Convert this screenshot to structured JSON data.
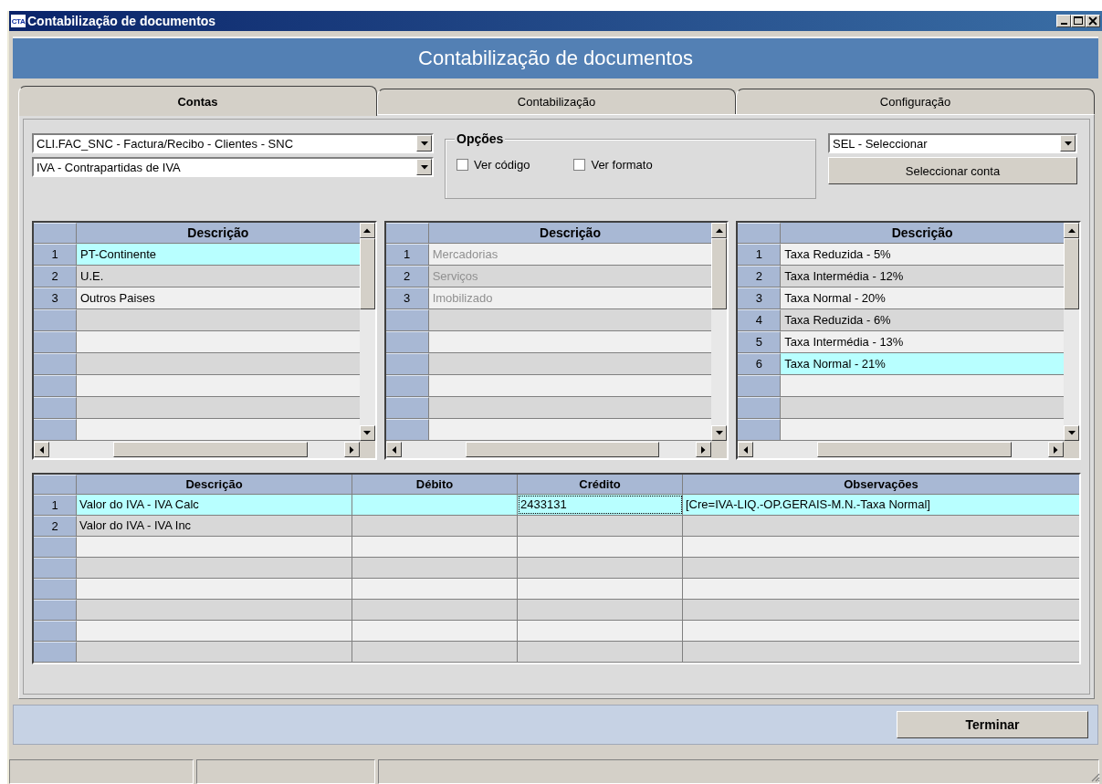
{
  "window": {
    "icon_label": "CTA",
    "title": "Contabilização de documentos"
  },
  "banner": "Contabilização de documentos",
  "tabs": [
    {
      "label": "Contas",
      "selected": true
    },
    {
      "label": "Contabilização",
      "selected": false
    },
    {
      "label": "Configuração",
      "selected": false
    }
  ],
  "document_type": {
    "value": "CLI.FAC_SNC - Factura/Recibo - Clientes - SNC"
  },
  "counterpart": {
    "value": "IVA - Contrapartidas de IVA"
  },
  "options": {
    "title": "Opções",
    "checkboxes": [
      {
        "label": "Ver código",
        "checked": false
      },
      {
        "label": "Ver formato",
        "checked": false
      }
    ]
  },
  "selection": {
    "value": "SEL - Seleccionar"
  },
  "select_account_button": "Seleccionar conta",
  "top_grids": [
    {
      "header": "Descrição",
      "disabled": false,
      "rows": [
        {
          "number": "1",
          "text": "PT-Continente",
          "selected": true
        },
        {
          "number": "2",
          "text": "U.E.",
          "selected": false
        },
        {
          "number": "3",
          "text": "Outros Paises",
          "selected": false
        }
      ]
    },
    {
      "header": "Descrição",
      "disabled": true,
      "rows": [
        {
          "number": "1",
          "text": "Mercadorias",
          "selected": false
        },
        {
          "number": "2",
          "text": "Serviços",
          "selected": false
        },
        {
          "number": "3",
          "text": "Imobilizado",
          "selected": false
        }
      ]
    },
    {
      "header": "Descrição",
      "disabled": false,
      "rows": [
        {
          "number": "1",
          "text": "Taxa Reduzida - 5%",
          "selected": false
        },
        {
          "number": "2",
          "text": "Taxa Intermédia - 12%",
          "selected": false
        },
        {
          "number": "3",
          "text": "Taxa Normal - 20%",
          "selected": false
        },
        {
          "number": "4",
          "text": "Taxa Reduzida - 6%",
          "selected": false
        },
        {
          "number": "5",
          "text": "Taxa Intermédia - 13%",
          "selected": false
        },
        {
          "number": "6",
          "text": "Taxa Normal - 21%",
          "selected": true
        }
      ]
    }
  ],
  "entries": {
    "columns": [
      "Descrição",
      "Débito",
      "Crédito",
      "Observações"
    ],
    "rows": [
      {
        "number": "1",
        "selected": true,
        "cells": [
          {
            "text": "Valor do IVA - IVA Calc",
            "focused": false
          },
          null,
          {
            "text": "2433131",
            "focused": true
          },
          {
            "text": "[Cre=IVA-LIQ.-OP.GERAIS-M.N.-Taxa Normal]",
            "focused": false
          }
        ]
      },
      {
        "number": "2",
        "selected": false,
        "cells": [
          {
            "text": "Valor do IVA - IVA Inc",
            "focused": false
          },
          null,
          null,
          null
        ]
      }
    ]
  },
  "finish_button": "Terminar"
}
